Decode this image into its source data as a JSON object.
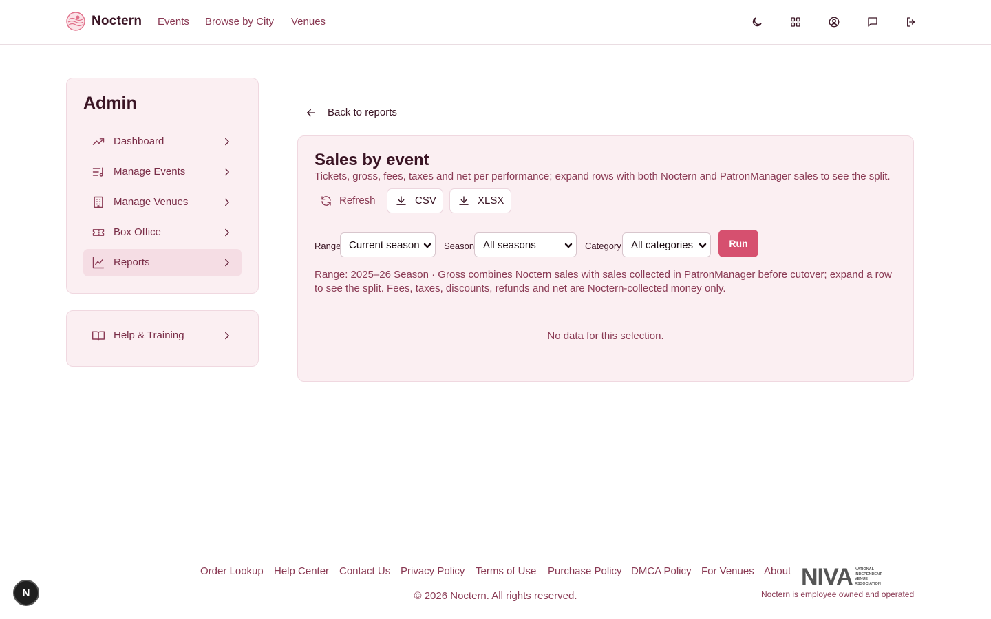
{
  "header": {
    "brand": "Noctern",
    "nav": [
      {
        "label": "Events"
      },
      {
        "label": "Browse by City"
      },
      {
        "label": "Venues"
      }
    ],
    "icons": [
      "moon-icon",
      "grid-icon",
      "user-circle-icon",
      "message-icon",
      "logout-icon"
    ]
  },
  "sidebar": {
    "title": "Admin",
    "items": [
      {
        "label": "Dashboard",
        "icon": "trending-up-icon"
      },
      {
        "label": "Manage Events",
        "icon": "list-music-icon"
      },
      {
        "label": "Manage Venues",
        "icon": "building-icon"
      },
      {
        "label": "Box Office",
        "icon": "ticket-icon"
      },
      {
        "label": "Reports",
        "icon": "line-chart-icon",
        "active": true
      }
    ],
    "help": {
      "label": "Help & Training",
      "icon": "book-open-icon"
    }
  },
  "main": {
    "back_label": "Back to reports",
    "title": "Sales by event",
    "description": "Tickets, gross, fees, taxes and net per performance; expand rows with both Noctern and PatronManager sales to see the split.",
    "buttons": {
      "refresh": "Refresh",
      "csv": "CSV",
      "xlsx": "XLSX"
    },
    "filters": {
      "range_label": "Range",
      "range_value": "Current season",
      "season_label": "Season",
      "season_value": "All seasons",
      "category_label": "Category",
      "category_value": "All categories"
    },
    "run_label": "Run",
    "range_note": "Range: 2025–26 Season · Gross combines Noctern sales with sales collected in PatronManager before cutover; expand a row to see the split. Fees, taxes, discounts, refunds and net are Noctern-collected money only.",
    "empty_text": "No data for this selection."
  },
  "footer": {
    "links": [
      {
        "label": "Order Lookup"
      },
      {
        "label": "Help Center"
      },
      {
        "label": "Contact Us"
      },
      {
        "label": "Privacy Policy"
      },
      {
        "label": "Terms of Use"
      },
      {
        "label": "Purchase Policy"
      },
      {
        "label": "DMCA Policy"
      },
      {
        "label": "For Venues"
      },
      {
        "label": "About"
      }
    ],
    "copyright": "© 2026 Noctern. All rights reserved.",
    "niva_mark": "NIVA",
    "niva_small": [
      "NATIONAL",
      "INDEPENDENT",
      "VENUE",
      "ASSOCIATION"
    ],
    "owned_text": "Noctern is employee owned and operated"
  },
  "dev_badge": "N",
  "colors": {
    "accent": "#d6506f",
    "panel_bg": "#fbeff2",
    "text_muted": "#8a3a54",
    "text_dark": "#3a1424"
  }
}
